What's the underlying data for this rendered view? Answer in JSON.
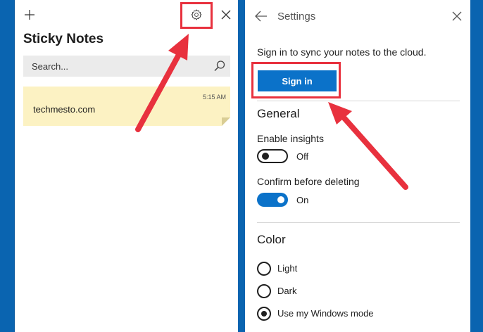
{
  "left_panel": {
    "add_icon": "plus-icon",
    "settings_icon": "gear-icon",
    "close_icon": "close-icon",
    "title": "Sticky Notes",
    "search": {
      "placeholder": "Search...",
      "value": "",
      "icon": "search-icon"
    },
    "notes": [
      {
        "time": "5:15 AM",
        "text": "techmesto.com",
        "color": "#fcf2c3"
      }
    ]
  },
  "right_panel": {
    "back_icon": "back-arrow-icon",
    "title": "Settings",
    "close_icon": "close-icon",
    "sync_text": "Sign in to sync your notes to the cloud.",
    "signin_label": "Sign in",
    "general": {
      "title": "General",
      "insights_label": "Enable insights",
      "insights_state": "Off",
      "confirm_label": "Confirm before deleting",
      "confirm_state": "On"
    },
    "color": {
      "title": "Color",
      "options": [
        "Light",
        "Dark",
        "Use my Windows mode"
      ],
      "selected": "Use my Windows mode"
    }
  },
  "colors": {
    "accent": "#0b72c9",
    "background": "#0a64b0",
    "annotation": "#e8313e",
    "note": "#fcf2c3"
  }
}
